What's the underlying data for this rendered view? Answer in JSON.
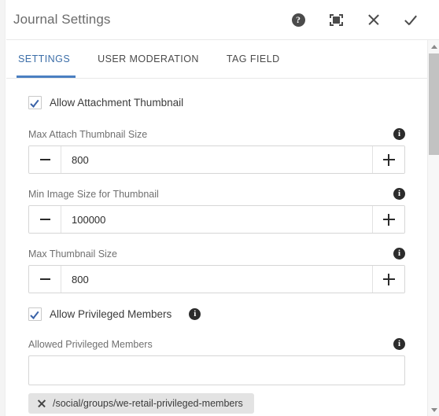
{
  "header": {
    "title": "Journal Settings",
    "actions": [
      {
        "name": "help-icon",
        "glyph": "?"
      },
      {
        "name": "maximize-icon",
        "glyph": "maximize"
      },
      {
        "name": "close-icon",
        "glyph": "✕"
      },
      {
        "name": "confirm-icon",
        "glyph": "✓"
      }
    ]
  },
  "tabs": [
    {
      "label": "SETTINGS",
      "active": true
    },
    {
      "label": "USER MODERATION",
      "active": false
    },
    {
      "label": "TAG FIELD",
      "active": false
    }
  ],
  "form": {
    "allow_attachment_thumbnail": {
      "label": "Allow Attachment Thumbnail",
      "checked": true
    },
    "max_attach_thumbnail_size": {
      "label": "Max Attach Thumbnail Size",
      "value": "800",
      "minus": "−",
      "plus": "+",
      "info": "i"
    },
    "min_image_size_for_thumbnail": {
      "label": "Min Image Size for Thumbnail",
      "value": "100000",
      "minus": "−",
      "plus": "+",
      "info": "i"
    },
    "max_thumbnail_size": {
      "label": "Max Thumbnail Size",
      "value": "800",
      "minus": "−",
      "plus": "+",
      "info": "i"
    },
    "allow_privileged_members": {
      "label": "Allow Privileged Members",
      "checked": true,
      "info": "i"
    },
    "allowed_privileged_members": {
      "label": "Allowed Privileged Members",
      "value": "",
      "placeholder": "",
      "info": "i",
      "chips": [
        {
          "label": "/social/groups/we-retail-privileged-members"
        }
      ]
    }
  },
  "scrollbar": {
    "up_arrow": "▲",
    "down_arrow": "▼"
  },
  "colors": {
    "accent": "#4a7fc1",
    "active_tab_text": "#3c6ea8",
    "checkbox_check": "#3b63a8",
    "chip_bg": "#e3e3e3",
    "info_icon_bg": "#2c2c2c",
    "border": "#d6d6d6"
  }
}
